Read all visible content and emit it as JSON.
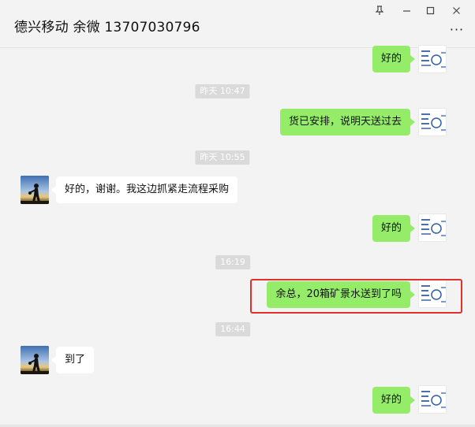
{
  "window": {
    "title": "德兴移动 余微 13707030796",
    "controls": {
      "pin": "⊥",
      "minimize": "—",
      "maximize": "☐",
      "close": "✕"
    },
    "more_menu": "···"
  },
  "messages": [
    {
      "type": "message",
      "side": "me",
      "text": "好的"
    },
    {
      "type": "time",
      "text": "昨天 10:47"
    },
    {
      "type": "message",
      "side": "me",
      "text": "货已安排，说明天送过去"
    },
    {
      "type": "time",
      "text": "昨天 10:55"
    },
    {
      "type": "message",
      "side": "them",
      "text": "好的，谢谢。我这边抓紧走流程采购"
    },
    {
      "type": "message",
      "side": "me",
      "text": "好的"
    },
    {
      "type": "time",
      "text": "16:19"
    },
    {
      "type": "message",
      "side": "me",
      "text": "余总，20箱矿景水送到了吗",
      "highlighted": true
    },
    {
      "type": "time",
      "text": "16:44"
    },
    {
      "type": "message",
      "side": "them",
      "text": "到了"
    },
    {
      "type": "message",
      "side": "me",
      "text": "好的"
    }
  ],
  "colors": {
    "my_bubble": "#95ec69",
    "their_bubble": "#ffffff",
    "highlight": "#e0302a",
    "timestamp_bg": "#dadada"
  }
}
